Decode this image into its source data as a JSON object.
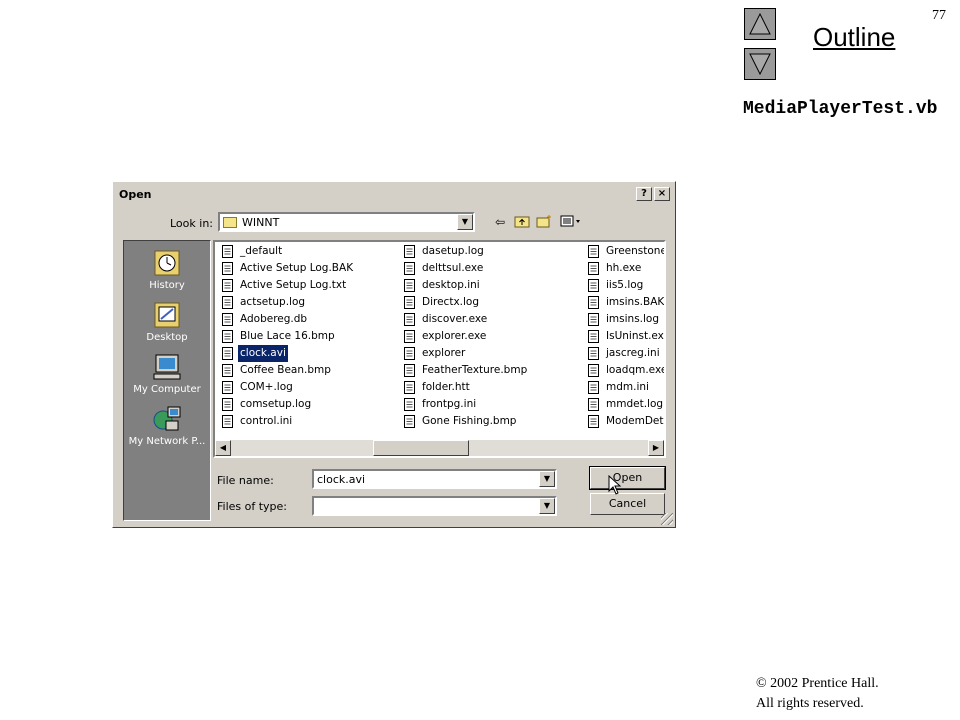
{
  "slide": {
    "number": "77",
    "outline_label": "Outline",
    "file_title": "MediaPlayerTest.vb",
    "copyright_line1": "© 2002 Prentice Hall.",
    "copyright_line2": "All rights reserved."
  },
  "dialog": {
    "title": "Open",
    "help_button": "?",
    "close_button": "×",
    "look_in_label": "Look in:",
    "look_in_value": "WINNT",
    "places": [
      {
        "label": "History",
        "icon": "history-icon"
      },
      {
        "label": "Desktop",
        "icon": "desktop-icon"
      },
      {
        "label": "My Computer",
        "icon": "my-computer-icon"
      },
      {
        "label": "My Network P...",
        "icon": "network-places-icon"
      }
    ],
    "files": [
      [
        "_default",
        "Active Setup Log.BAK",
        "Active Setup Log.txt",
        "actsetup.log",
        "Adobereg.db",
        "Blue Lace 16.bmp",
        "clock.avi",
        "Coffee Bean.bmp",
        "COM+.log",
        "comsetup.log",
        "control.ini"
      ],
      [
        "dasetup.log",
        "delttsul.exe",
        "desktop.ini",
        "Directx.log",
        "discover.exe",
        "explorer.exe",
        "explorer",
        "FeatherTexture.bmp",
        "folder.htt",
        "frontpg.ini",
        "Gone Fishing.bmp"
      ],
      [
        "Greenstone.b",
        "hh.exe",
        "iis5.log",
        "imsins.BAK",
        "imsins.log",
        "IsUninst.exe",
        "jascreg.ini",
        "loadqm.exe",
        "mdm.ini",
        "mmdet.log",
        "ModemDet.tx"
      ]
    ],
    "selected_file": "clock.avi",
    "file_name_label": "File name:",
    "file_name_value": "clock.avi",
    "files_of_type_label": "Files of type:",
    "files_of_type_value": "",
    "open_button": "Open",
    "cancel_button": "Cancel"
  }
}
